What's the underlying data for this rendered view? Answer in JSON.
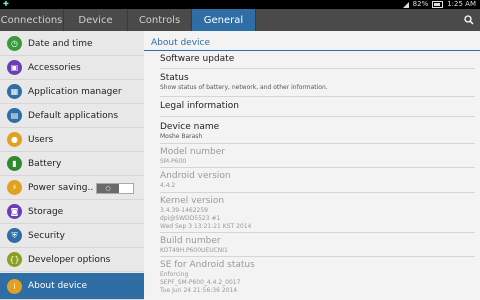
{
  "status_bar": {
    "battery": "82%",
    "time": "1:25 AM"
  },
  "tabs": [
    {
      "label": "Connections"
    },
    {
      "label": "Device"
    },
    {
      "label": "Controls"
    },
    {
      "label": "General"
    }
  ],
  "sidebar": {
    "items": [
      {
        "label": "Date and time",
        "icon": "clock-icon",
        "color": "#3a9a3a"
      },
      {
        "label": "Accessories",
        "icon": "accessories-icon",
        "color": "#6a3fb5"
      },
      {
        "label": "Application manager",
        "icon": "apps-grid-icon",
        "color": "#2f6ea5"
      },
      {
        "label": "Default applications",
        "icon": "default-apps-icon",
        "color": "#2f6ea5"
      },
      {
        "label": "Users",
        "icon": "users-icon",
        "color": "#e0a020"
      },
      {
        "label": "Battery",
        "icon": "battery-icon",
        "color": "#2f8a2f"
      },
      {
        "label": "Power saving..",
        "icon": "power-saving-icon",
        "color": "#e0a020"
      },
      {
        "label": "Storage",
        "icon": "storage-icon",
        "color": "#6a3fb5"
      },
      {
        "label": "Security",
        "icon": "security-icon",
        "color": "#2f6ea5"
      },
      {
        "label": "Developer options",
        "icon": "developer-icon",
        "color": "#8aa020"
      },
      {
        "label": "About device",
        "icon": "info-icon",
        "color": "#e0a020"
      }
    ],
    "power_saving_toggle": "off"
  },
  "main": {
    "header": "About device",
    "entries": [
      {
        "title": "Software update",
        "sub": []
      },
      {
        "title": "Status",
        "sub": [
          "Show status of battery, network, and other information."
        ]
      },
      {
        "title": "Legal information",
        "sub": []
      },
      {
        "title": "Device name",
        "sub": [
          "Moshe Barash"
        ]
      },
      {
        "title": "Model number",
        "sub": [
          "SM-P600"
        ]
      },
      {
        "title": "Android version",
        "sub": [
          "4.4.2"
        ]
      },
      {
        "title": "Kernel version",
        "sub": [
          "3.4.39-1462259",
          "dpi@SWDD5523 #1",
          "Wed Sep 3 13:21:21 KST 2014"
        ]
      },
      {
        "title": "Build number",
        "sub": [
          "KOT49H.P600UEUCNI1"
        ]
      },
      {
        "title": "SE for Android status",
        "sub": [
          "Enforcing",
          "SEPF_SM-P600_4.4.2_0017",
          "Tue Jun 24 21:56:36 2014"
        ]
      }
    ]
  }
}
